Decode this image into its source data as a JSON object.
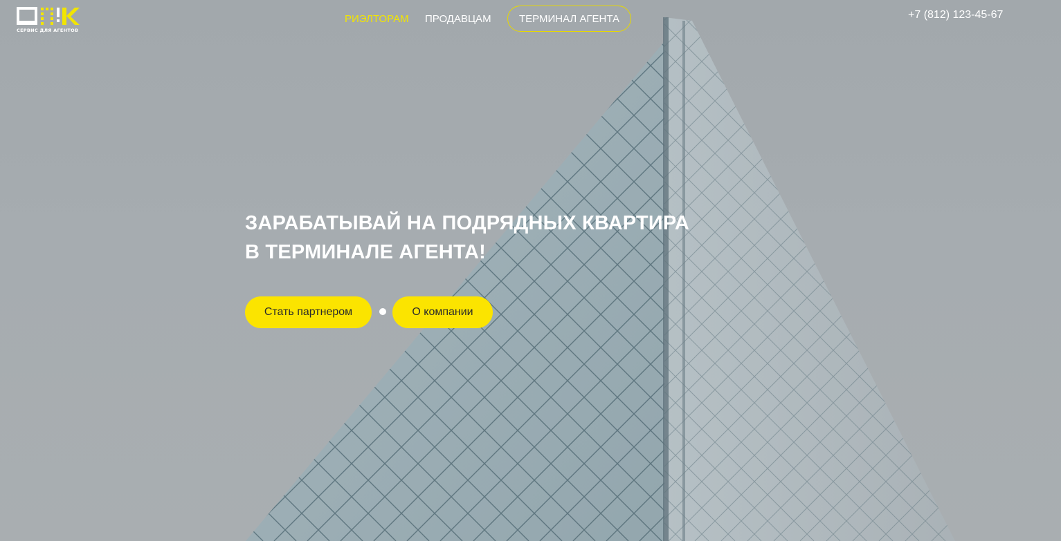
{
  "header": {
    "logo_caption": "СЕРВИС ДЛЯ АГЕНТОВ",
    "nav": {
      "realtors": "РИЭЛТОРАМ",
      "sellers": "ПРОДАВЦАМ",
      "terminal": "ТЕРМИНАЛ АГЕНТА"
    },
    "phone": "+7 (812) 123-45-67"
  },
  "hero": {
    "headline_line1": "ЗАРАБАТЫВАЙ НА ПОДРЯДНЫХ КВАРТИРА",
    "headline_line2": "В ТЕРМИНАЛЕ АГЕНТА!",
    "btn_partner": "Стать партнером",
    "btn_about": "О компании"
  },
  "colors": {
    "accent": "#fbe400",
    "nav_active": "#f2e500",
    "text": "#ffffff",
    "background": "#a3a9ad"
  },
  "icons": {
    "logo": "apk-logo-icon"
  }
}
